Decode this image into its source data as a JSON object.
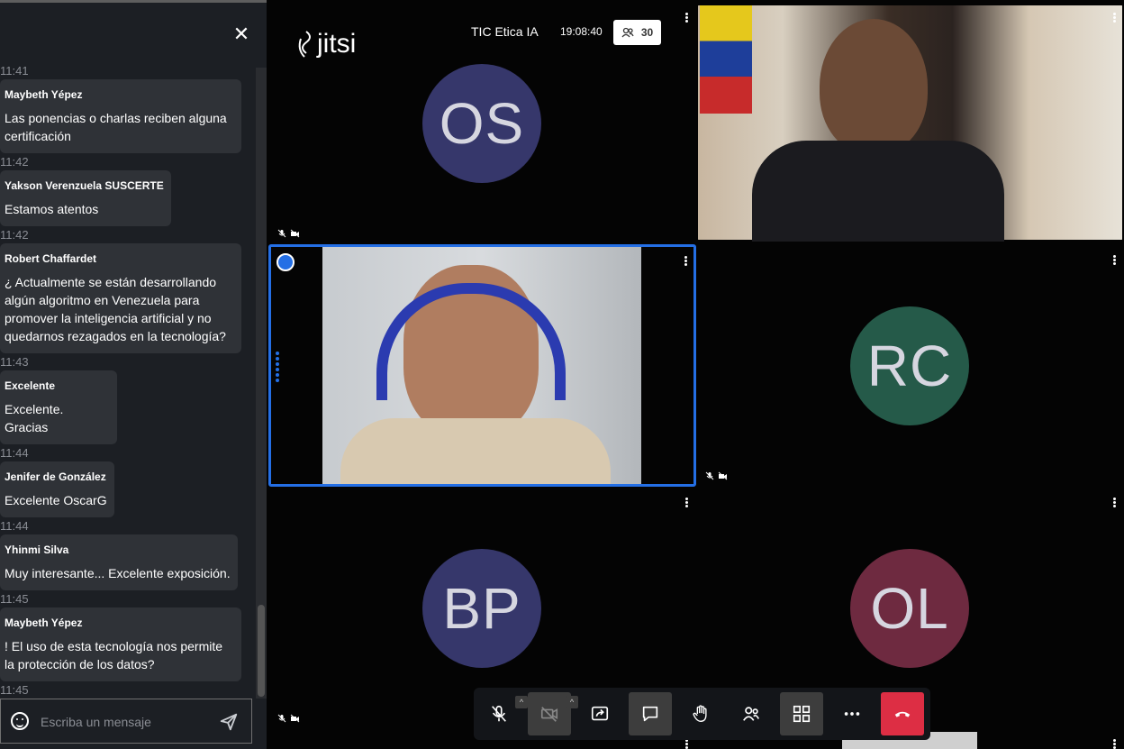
{
  "chat": {
    "top_time": "11:41",
    "messages": [
      {
        "name": "Maybeth Yépez",
        "text": "Las ponencias o charlas reciben alguna certificación",
        "time": "11:42"
      },
      {
        "name": "Yakson Verenzuela SUSCERTE",
        "text": "Estamos atentos",
        "time": "11:42"
      },
      {
        "name": "Robert Chaffardet",
        "text": "¿ Actualmente se están desarrollando algún  algoritmo en Venezuela para promover la inteligencia artificial y no quedarnos rezagados en la tecnología?",
        "time": "11:43"
      },
      {
        "name": "Excelente",
        "text": "Excelente. Gracias",
        "time": "11:44"
      },
      {
        "name": "Jenifer de González",
        "text": "Excelente OscarG",
        "time": "11:44"
      },
      {
        "name": "Yhinmi Silva",
        "text": "Muy interesante... Excelente exposición.",
        "time": "11:45"
      },
      {
        "name": "Maybeth Yépez",
        "text": "! El uso de esta tecnología nos permite la protección de los datos?",
        "time": "11:45"
      }
    ],
    "input_placeholder": "Escriba un mensaje"
  },
  "header": {
    "logo_text": "jitsi",
    "meeting_title": "TIC Etica IA",
    "meeting_time": "19:08:40",
    "participant_count": "30"
  },
  "tiles": {
    "os": {
      "initials": "OS",
      "color": "#36376b"
    },
    "rc": {
      "initials": "RC",
      "color": "#255a49"
    },
    "bp": {
      "initials": "BP",
      "color": "#36376b"
    },
    "ol": {
      "initials": "OL",
      "color": "#6e2a40"
    }
  },
  "colors": {
    "accent": "#246fe5",
    "hangup": "#dd2e44"
  }
}
